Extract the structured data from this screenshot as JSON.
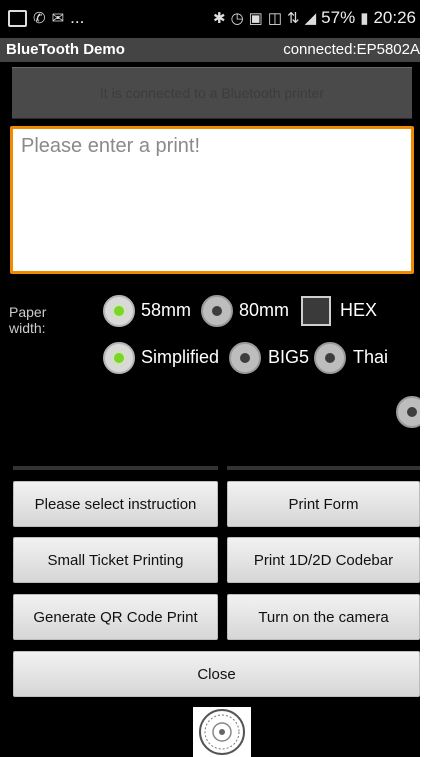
{
  "status_bar": {
    "left_icons": [
      "image-icon",
      "whatsapp-icon",
      "message-icon",
      "more-icon"
    ],
    "more_text": "...",
    "battery": "57%",
    "time": "20:26"
  },
  "title_bar": {
    "app_title": "BlueTooth Demo",
    "connection": "connected:EP5802A"
  },
  "connection_status": "It is connected to a Bluetooth printer",
  "input": {
    "value": "",
    "placeholder": "Please enter a print!"
  },
  "paper_width": {
    "label": "Paper width:",
    "options": [
      {
        "label": "58mm",
        "selected": true
      },
      {
        "label": "80mm",
        "selected": false
      }
    ]
  },
  "hex": {
    "label": "HEX",
    "checked": false
  },
  "encoding": {
    "options": [
      {
        "label": "Simplified",
        "selected": true
      },
      {
        "label": "BIG5",
        "selected": false
      },
      {
        "label": "Thai",
        "selected": false
      }
    ]
  },
  "buttons": {
    "select_instruction": "Please select instruction",
    "print_form": "Print Form",
    "small_ticket": "Small Ticket Printing",
    "print_codebar": "Print 1D/2D Codebar",
    "qr_code": "Generate QR Code Print",
    "camera": "Turn on the camera",
    "close": "Close"
  },
  "colors": {
    "input_border": "#f08a00",
    "radio_selected": "#7bd428",
    "background": "#000000"
  }
}
